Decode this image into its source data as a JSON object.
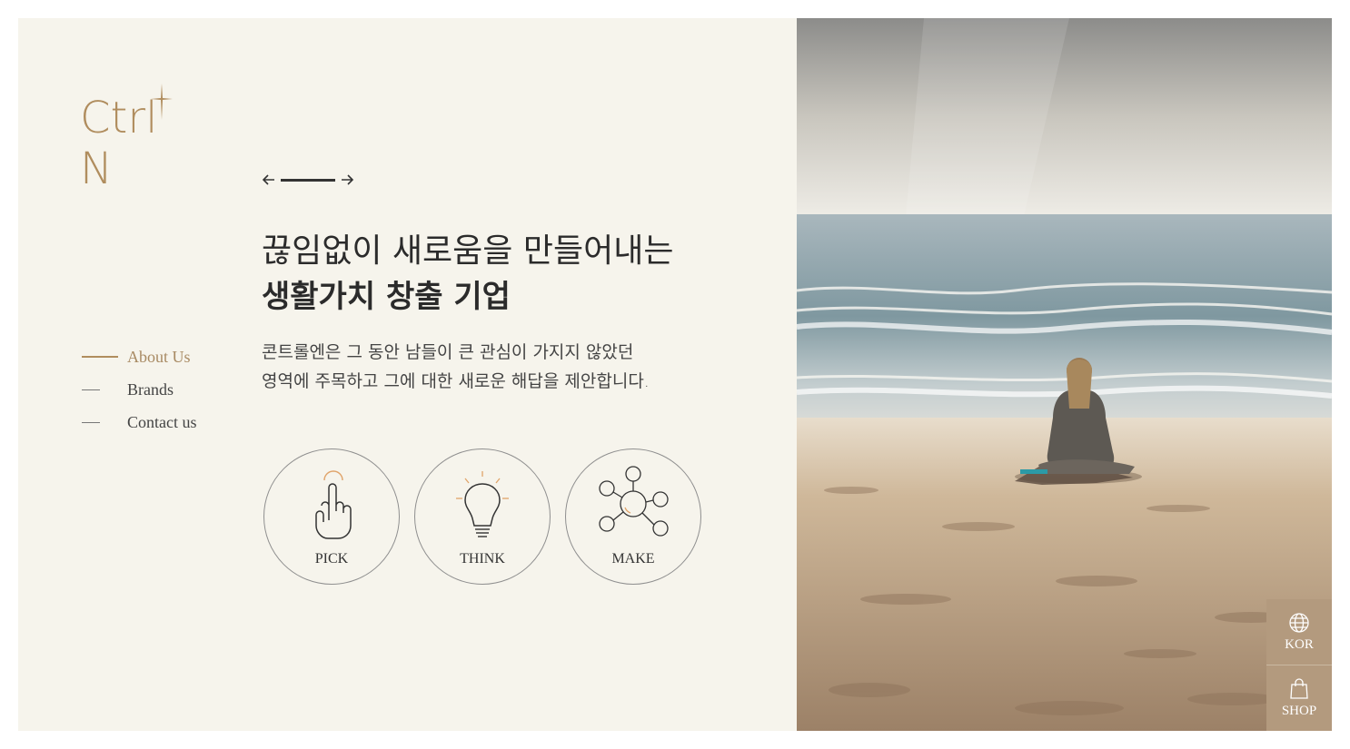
{
  "brand": {
    "logo_text": "Ctrl N",
    "accent": "#b08d5e"
  },
  "nav": {
    "items": [
      {
        "label": "About Us",
        "active": true
      },
      {
        "label": "Brands",
        "active": false
      },
      {
        "label": "Contact us",
        "active": false
      }
    ]
  },
  "slider": {
    "prev_icon": "arrow-left-icon",
    "next_icon": "arrow-right-icon"
  },
  "hero": {
    "line1": "끊임없이 새로움을 만들어내는",
    "line2": "생활가치 창출 기업",
    "desc_line1": "콘트롤엔은 그 동안 남들이 큰 관심이 가지지 않았던",
    "desc_line2": "영역에 주목하고 그에 대한 새로운 해답을 제안합니다."
  },
  "values": [
    {
      "label": "PICK",
      "icon": "hand-pointer-icon"
    },
    {
      "label": "THINK",
      "icon": "lightbulb-icon"
    },
    {
      "label": "MAKE",
      "icon": "network-icon"
    }
  ],
  "side_buttons": {
    "lang": {
      "label": "KOR",
      "icon": "globe-icon"
    },
    "shop": {
      "label": "SHOP",
      "icon": "shopping-bag-icon"
    },
    "color": "#b39a7e"
  }
}
